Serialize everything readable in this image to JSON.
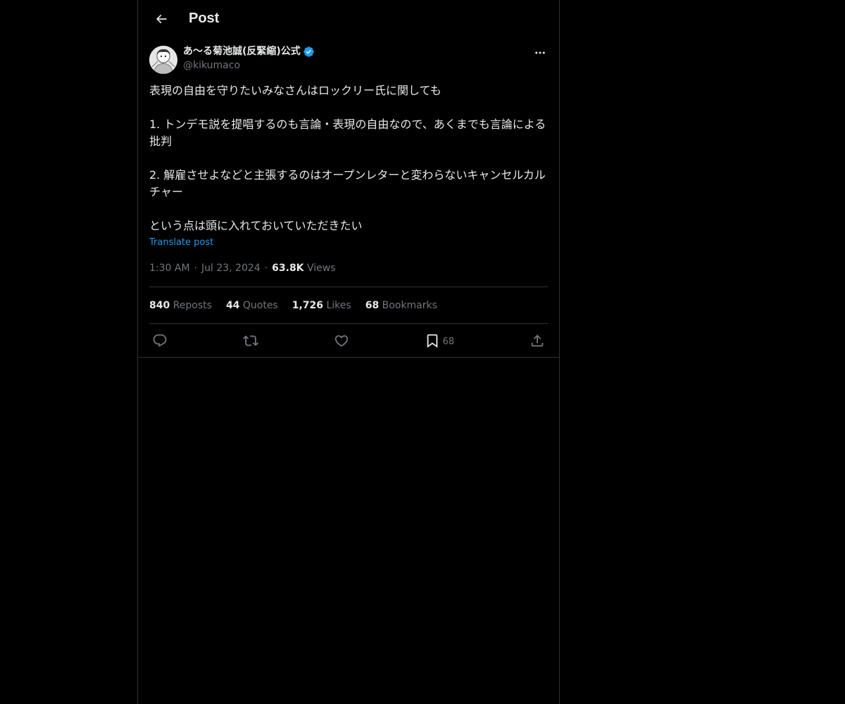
{
  "header": {
    "title": "Post"
  },
  "post": {
    "author": {
      "display_name": "あ〜る菊池誠(反緊縮)公式",
      "handle": "@kikumaco",
      "verified": true
    },
    "text": "表現の自由を守りたいみなさんはロックリー氏に関しても\n\n1. トンデモ説を提唱するのも言論・表現の自由なので、あくまでも言論による批判\n\n2. 解雇させよなどと主張するのはオープンレターと変わらないキャンセルカルチャー\n\nという点は頭に入れておいていただきたい",
    "translate_label": "Translate post",
    "time": "1:30 AM",
    "date": "Jul 23, 2024",
    "views_count": "63.8K",
    "views_label": "Views"
  },
  "stats": [
    {
      "count": "840",
      "label": "Reposts"
    },
    {
      "count": "44",
      "label": "Quotes"
    },
    {
      "count": "1,726",
      "label": "Likes"
    },
    {
      "count": "68",
      "label": "Bookmarks"
    }
  ],
  "actions": {
    "reply_icon": "reply-icon",
    "repost_icon": "repost-icon",
    "like_icon": "heart-icon",
    "bookmark_icon": "bookmark-icon",
    "bookmark_count": "68",
    "share_icon": "share-icon"
  },
  "colors": {
    "background": "#000000",
    "text": "#e7e9ea",
    "muted": "#71767b",
    "accent": "#1d9bf0",
    "border": "#2f3336"
  }
}
